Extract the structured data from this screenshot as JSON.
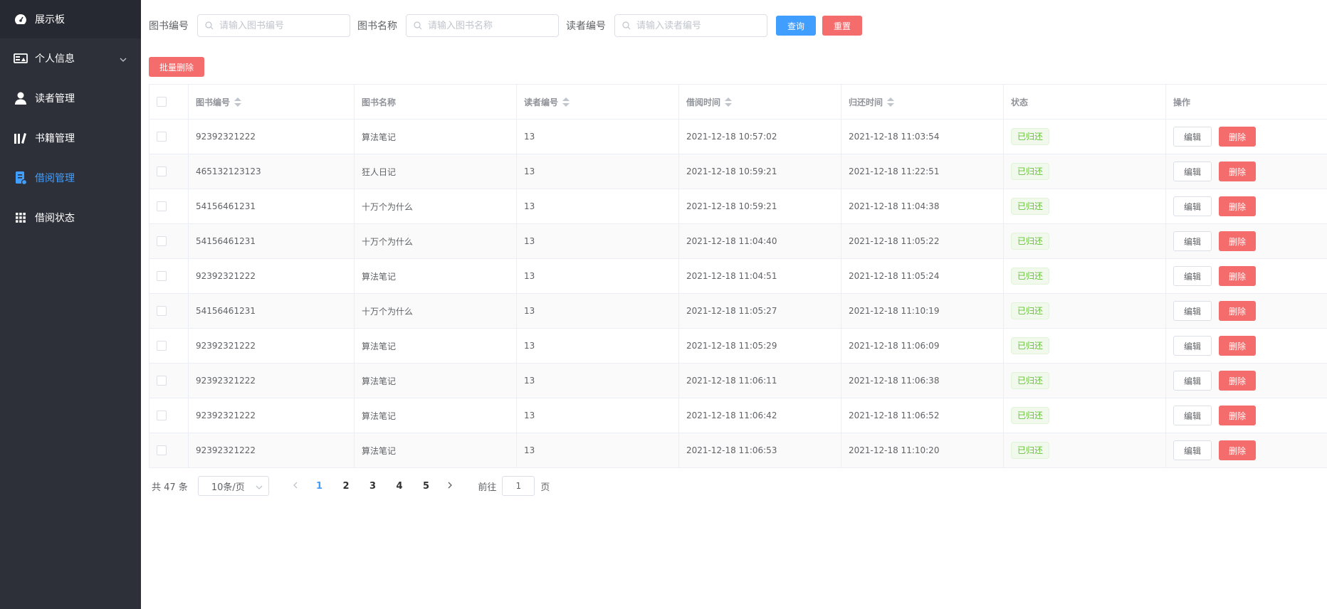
{
  "sidebar": {
    "items": [
      {
        "label": "展示板",
        "icon": "dashboard-icon"
      },
      {
        "label": "个人信息",
        "icon": "id-card-icon",
        "has_submenu": true
      },
      {
        "label": "读者管理",
        "icon": "user-icon"
      },
      {
        "label": "书籍管理",
        "icon": "books-icon"
      },
      {
        "label": "借阅管理",
        "icon": "borrow-icon",
        "active": true
      },
      {
        "label": "借阅状态",
        "icon": "grid-icon"
      }
    ],
    "active_color": "#409eff"
  },
  "search": {
    "book_no_label": "图书编号",
    "book_no_placeholder": "请输入图书编号",
    "book_name_label": "图书名称",
    "book_name_placeholder": "请输入图书名称",
    "reader_no_label": "读者编号",
    "reader_no_placeholder": "请输入读者编号",
    "query_label": "查询",
    "reset_label": "重置"
  },
  "toolbar": {
    "batch_delete_label": "批量删除"
  },
  "table": {
    "headers": [
      "图书编号",
      "图书名称",
      "读者编号",
      "借阅时间",
      "归还时间",
      "状态",
      "操作"
    ],
    "edit_label": "编辑",
    "delete_label": "删除",
    "rows": [
      {
        "book_no": "92392321222",
        "book_name": "算法笔记",
        "reader_no": "13",
        "borrow_time": "2021-12-18 10:57:02",
        "return_time": "2021-12-18 11:03:54",
        "status": "已归还"
      },
      {
        "book_no": "465132123123",
        "book_name": "狂人日记",
        "reader_no": "13",
        "borrow_time": "2021-12-18 10:59:21",
        "return_time": "2021-12-18 11:22:51",
        "status": "已归还"
      },
      {
        "book_no": "54156461231",
        "book_name": "十万个为什么",
        "reader_no": "13",
        "borrow_time": "2021-12-18 10:59:21",
        "return_time": "2021-12-18 11:04:38",
        "status": "已归还"
      },
      {
        "book_no": "54156461231",
        "book_name": "十万个为什么",
        "reader_no": "13",
        "borrow_time": "2021-12-18 11:04:40",
        "return_time": "2021-12-18 11:05:22",
        "status": "已归还"
      },
      {
        "book_no": "92392321222",
        "book_name": "算法笔记",
        "reader_no": "13",
        "borrow_time": "2021-12-18 11:04:51",
        "return_time": "2021-12-18 11:05:24",
        "status": "已归还"
      },
      {
        "book_no": "54156461231",
        "book_name": "十万个为什么",
        "reader_no": "13",
        "borrow_time": "2021-12-18 11:05:27",
        "return_time": "2021-12-18 11:10:19",
        "status": "已归还"
      },
      {
        "book_no": "92392321222",
        "book_name": "算法笔记",
        "reader_no": "13",
        "borrow_time": "2021-12-18 11:05:29",
        "return_time": "2021-12-18 11:06:09",
        "status": "已归还"
      },
      {
        "book_no": "92392321222",
        "book_name": "算法笔记",
        "reader_no": "13",
        "borrow_time": "2021-12-18 11:06:11",
        "return_time": "2021-12-18 11:06:38",
        "status": "已归还"
      },
      {
        "book_no": "92392321222",
        "book_name": "算法笔记",
        "reader_no": "13",
        "borrow_time": "2021-12-18 11:06:42",
        "return_time": "2021-12-18 11:06:52",
        "status": "已归还"
      },
      {
        "book_no": "92392321222",
        "book_name": "算法笔记",
        "reader_no": "13",
        "borrow_time": "2021-12-18 11:06:53",
        "return_time": "2021-12-18 11:10:20",
        "status": "已归还"
      }
    ]
  },
  "pagination": {
    "total_text": "共 47 条",
    "page_size": "10条/页",
    "pages": [
      "1",
      "2",
      "3",
      "4",
      "5"
    ],
    "current_page": "1",
    "goto_prefix": "前往",
    "goto_value": "1",
    "goto_suffix": "页"
  }
}
